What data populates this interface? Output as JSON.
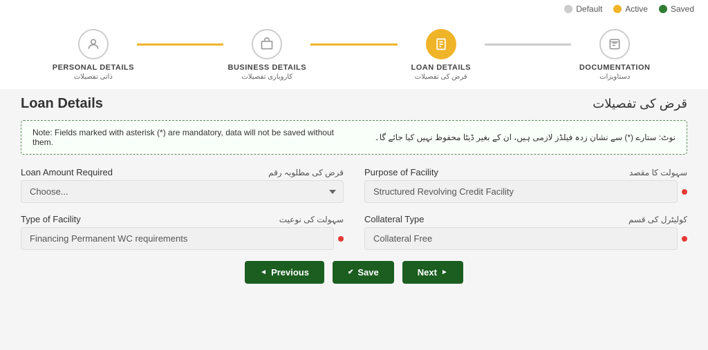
{
  "status_bar": {
    "items": [
      {
        "label": "Default",
        "dot_class": "dot-default"
      },
      {
        "label": "Active",
        "dot_class": "dot-active"
      },
      {
        "label": "Saved",
        "dot_class": "dot-saved"
      }
    ]
  },
  "stepper": {
    "steps": [
      {
        "label": "PERSONAL DETAILS",
        "label_urdu": "ذاتی تفصیلات",
        "state": "default"
      },
      {
        "label": "BUSINESS DETAILS",
        "label_urdu": "کاروباری تفصیلات",
        "state": "default"
      },
      {
        "label": "LOAN DETAILS",
        "label_urdu": "قرض کی تفصیلات",
        "state": "active"
      },
      {
        "label": "DOCUMENTATION",
        "label_urdu": "دستاویزات",
        "state": "default"
      }
    ]
  },
  "section": {
    "title_en": "Loan Details",
    "title_ur": "قرض کی تفصیلات"
  },
  "note": {
    "text_en": "Note: Fields marked with asterisk (*) are mandatory, data will not be saved without them.",
    "text_ur": "نوٹ: ستارے (*) سے نشان زدہ فیلڈز لازمی ہیں، ان کے بغیر ڈیٹا محفوظ نہیں کیا جائے گا۔"
  },
  "form": {
    "loan_amount": {
      "label_en": "Loan Amount Required",
      "label_ur": "قرض کی مطلوبہ رقم",
      "placeholder": "Choose...",
      "value": ""
    },
    "purpose_of_facility": {
      "label_en": "Purpose of Facility",
      "label_ur": "سہولت کا مقصد",
      "value": "Structured Revolving Credit Facility"
    },
    "type_of_facility": {
      "label_en": "Type of Facility",
      "label_ur": "سہولت کی نوعیت",
      "value": "Financing Permanent WC requirements"
    },
    "collateral_type": {
      "label_en": "Collateral Type",
      "label_ur": "کولیٹرل کی قسم",
      "value": "Collateral Free"
    }
  },
  "buttons": {
    "previous": "Previous",
    "save": "Save",
    "next": "Next"
  }
}
